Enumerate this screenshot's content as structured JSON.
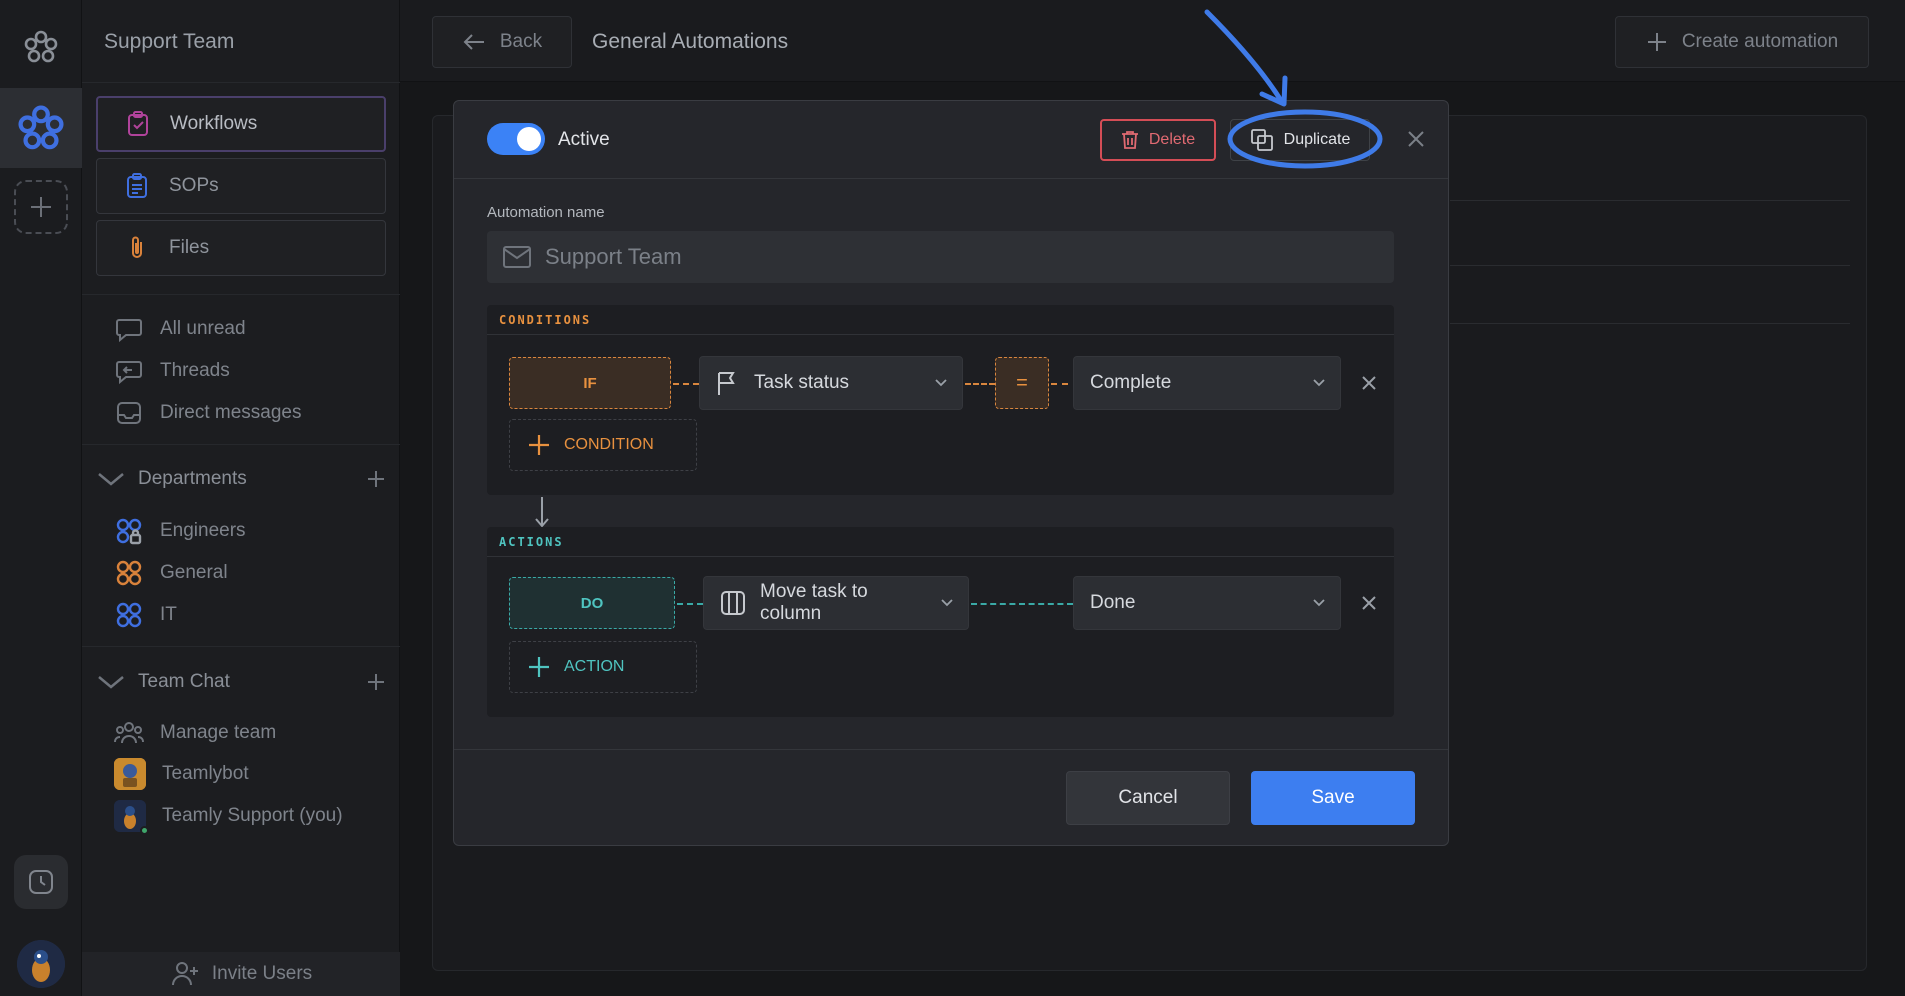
{
  "workspace": {
    "name": "Support Team"
  },
  "sidebar": {
    "nav_cards": [
      {
        "label": "Workflows",
        "icon": "clipboard-check-icon",
        "active": true
      },
      {
        "label": "SOPs",
        "icon": "list-document-icon",
        "active": false
      },
      {
        "label": "Files",
        "icon": "paperclip-icon",
        "active": false
      }
    ],
    "inbox": [
      {
        "label": "All unread",
        "icon": "chat-bubble-icon"
      },
      {
        "label": "Threads",
        "icon": "reply-bubble-icon"
      },
      {
        "label": "Direct messages",
        "icon": "inbox-icon"
      }
    ],
    "departments": {
      "title": "Departments",
      "items": [
        {
          "label": "Engineers",
          "icon": "group-lock-icon",
          "color": "#3f6fe0"
        },
        {
          "label": "General",
          "icon": "group-icon",
          "color": "#d9823b"
        },
        {
          "label": "IT",
          "icon": "group-icon",
          "color": "#3f6fe0"
        }
      ]
    },
    "team_chat": {
      "title": "Team Chat",
      "items": [
        {
          "label": "Manage team",
          "icon": "team-icon"
        },
        {
          "label": "Teamlybot",
          "icon": "bot-avatar"
        },
        {
          "label": "Teamly Support (you)",
          "icon": "user-avatar"
        }
      ]
    },
    "invite_label": "Invite Users"
  },
  "header": {
    "back_label": "Back",
    "title": "General Automations",
    "create_label": "Create automation"
  },
  "modal": {
    "active_label": "Active",
    "active_on": true,
    "delete_label": "Delete",
    "duplicate_label": "Duplicate",
    "name_label": "Automation name",
    "name_placeholder": "Support Team",
    "conditions": {
      "title": "CONDITIONS",
      "if_label": "IF",
      "field": "Task status",
      "operator": "=",
      "value": "Complete",
      "add_label": "CONDITION"
    },
    "actions": {
      "title": "ACTIONS",
      "do_label": "DO",
      "action": "Move task to column",
      "target": "Done",
      "add_label": "ACTION"
    },
    "cancel_label": "Cancel",
    "save_label": "Save"
  },
  "colors": {
    "accent": "#3b82f6",
    "condition": "#e8913f",
    "action": "#4fc4c0",
    "danger": "#e06a72",
    "annotation": "#3f7be8"
  }
}
